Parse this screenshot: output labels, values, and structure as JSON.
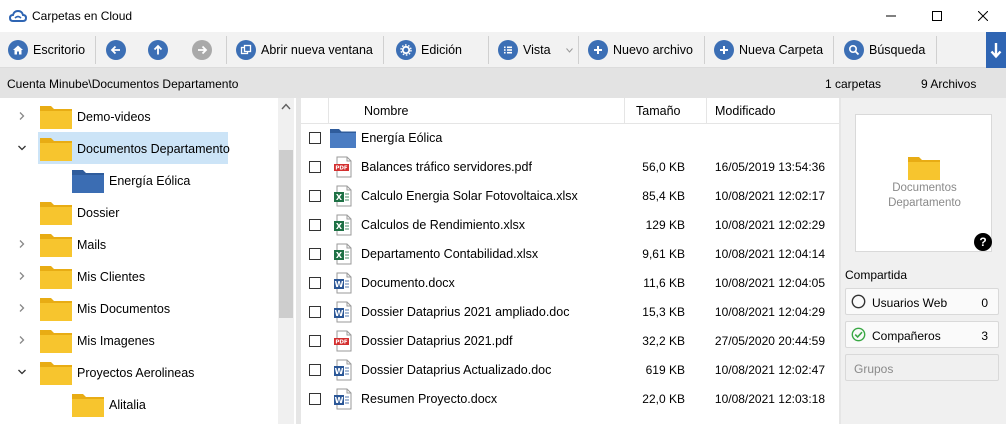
{
  "window": {
    "title": "Carpetas en Cloud"
  },
  "toolbar": {
    "desktop": "Escritorio",
    "open_window": "Abrir nueva ventana",
    "edit": "Edición",
    "view": "Vista",
    "new_file": "Nuevo archivo",
    "new_folder": "Nueva Carpeta",
    "search": "Búsqueda"
  },
  "pathbar": {
    "path": "Cuenta Minube\\Documentos Departamento",
    "folders": "1 carpetas",
    "files": "9 Archivos"
  },
  "tree": {
    "items": [
      {
        "label": "Demo-videos",
        "level": 0,
        "twisty": "collapsed"
      },
      {
        "label": "Documentos Departamento",
        "level": 0,
        "twisty": "expanded",
        "selected": true
      },
      {
        "label": "Energía Eólica",
        "level": 1,
        "twisty": "none",
        "blue": true
      },
      {
        "label": "Dossier",
        "level": 0,
        "twisty": "none"
      },
      {
        "label": "Mails",
        "level": 0,
        "twisty": "collapsed"
      },
      {
        "label": "Mis Clientes",
        "level": 0,
        "twisty": "collapsed"
      },
      {
        "label": "Mis Documentos",
        "level": 0,
        "twisty": "collapsed"
      },
      {
        "label": "Mis Imagenes",
        "level": 0,
        "twisty": "collapsed"
      },
      {
        "label": "Proyectos Aerolineas",
        "level": 0,
        "twisty": "expanded"
      },
      {
        "label": "Alitalia",
        "level": 1,
        "twisty": "none"
      }
    ]
  },
  "filelist": {
    "columns": {
      "name": "Nombre",
      "size": "Tamaño",
      "modified": "Modificado"
    },
    "rows": [
      {
        "type": "folder",
        "name": "Energía Eólica",
        "size": "",
        "date": ""
      },
      {
        "type": "pdf",
        "name": "Balances tráfico servidores.pdf",
        "size": "56,0 KB",
        "date": "16/05/2019 13:54:36"
      },
      {
        "type": "xlsx",
        "name": "Calculo Energia Solar Fotovoltaica.xlsx",
        "size": "85,4 KB",
        "date": "10/08/2021 12:02:17"
      },
      {
        "type": "xlsx",
        "name": "Calculos de Rendimiento.xlsx",
        "size": "129 KB",
        "date": "10/08/2021 12:02:29"
      },
      {
        "type": "xlsx",
        "name": "Departamento Contabilidad.xlsx",
        "size": "9,61 KB",
        "date": "10/08/2021 12:04:14"
      },
      {
        "type": "doc",
        "name": "Documento.docx",
        "size": "11,6 KB",
        "date": "10/08/2021 12:04:05"
      },
      {
        "type": "doc",
        "name": "Dossier Dataprius 2021 ampliado.doc",
        "size": "15,3 KB",
        "date": "10/08/2021 12:04:29"
      },
      {
        "type": "pdf",
        "name": "Dossier Dataprius 2021.pdf",
        "size": "32,2 KB",
        "date": "27/05/2020 20:44:59"
      },
      {
        "type": "doc",
        "name": "Dossier Dataprius Actualizado.doc",
        "size": "619 KB",
        "date": "10/08/2021 12:02:47"
      },
      {
        "type": "doc",
        "name": "Resumen Proyecto.docx",
        "size": "22,0 KB",
        "date": "10/08/2021 12:03:18"
      }
    ]
  },
  "side": {
    "preview_line1": "Documentos",
    "preview_line2": "Departamento",
    "help": "?",
    "share_title": "Compartida",
    "web_users": "Usuarios Web",
    "web_users_count": "0",
    "partners": "Compañeros",
    "partners_count": "3",
    "groups": "Grupos"
  },
  "colors": {
    "accent": "#3c6fb5",
    "selected": "#cce4f7",
    "folder_yellow": "#f7c52e",
    "folder_blue": "#4a7cc2",
    "pdf_red": "#d32f2f",
    "xlsx_green": "#1e7145",
    "doc_blue": "#2b5797",
    "check_green": "#3aa845"
  }
}
